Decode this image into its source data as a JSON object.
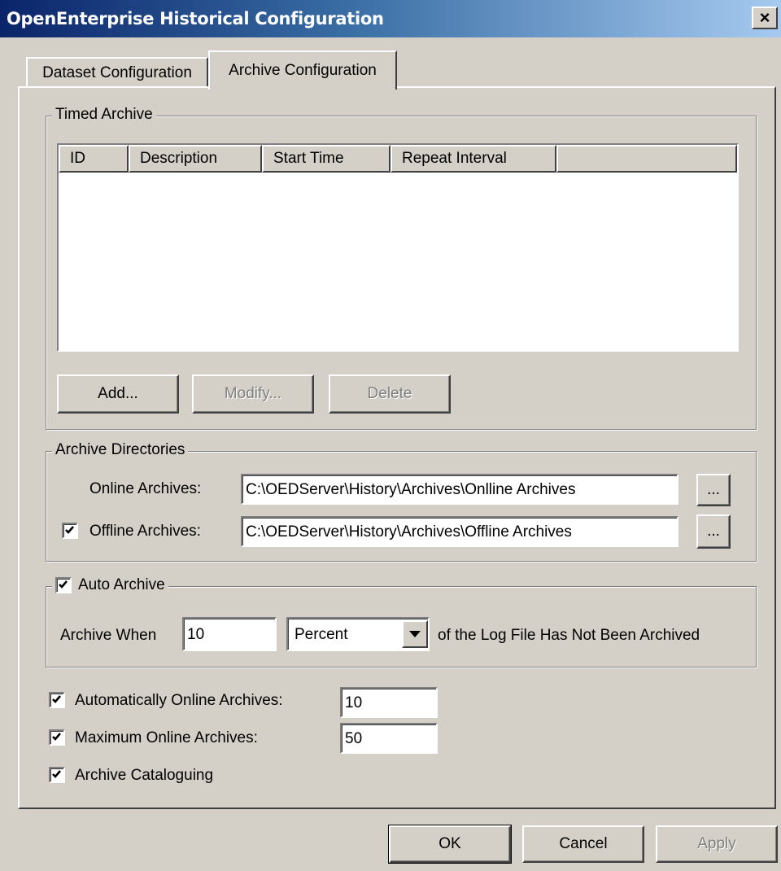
{
  "window": {
    "title": "OpenEnterprise Historical Configuration",
    "close_glyph": "×"
  },
  "tabs": [
    {
      "label": "Dataset Configuration",
      "selected": false
    },
    {
      "label": "Archive Configuration",
      "selected": true
    }
  ],
  "timed_archive": {
    "legend": "Timed Archive",
    "columns": [
      "ID",
      "Description",
      "Start Time",
      "Repeat Interval"
    ],
    "rows": [],
    "buttons": {
      "add": "Add...",
      "modify": "Modify...",
      "delete": "Delete"
    }
  },
  "archive_directories": {
    "legend": "Archive Directories",
    "online_label": "Online Archives:",
    "online_value": "C:\\OEDServer\\History\\Archives\\Onlline Archives",
    "offline_label": "Offline Archives:",
    "offline_checked": true,
    "offline_value": "C:\\OEDServer\\History\\Archives\\Offline Archives",
    "browse_label": "..."
  },
  "auto_archive": {
    "legend": "Auto Archive",
    "checked": true,
    "when_label": "Archive When",
    "value": "10",
    "unit": "Percent",
    "suffix": "of the Log File Has Not Been Archived"
  },
  "options": {
    "auto_online_label": "Automatically Online Archives:",
    "auto_online_checked": true,
    "auto_online_value": "10",
    "max_online_label": "Maximum Online Archives:",
    "max_online_checked": true,
    "max_online_value": "50",
    "cataloguing_label": "Archive Cataloguing",
    "cataloguing_checked": true
  },
  "footer": {
    "ok": "OK",
    "cancel": "Cancel",
    "apply": "Apply"
  }
}
